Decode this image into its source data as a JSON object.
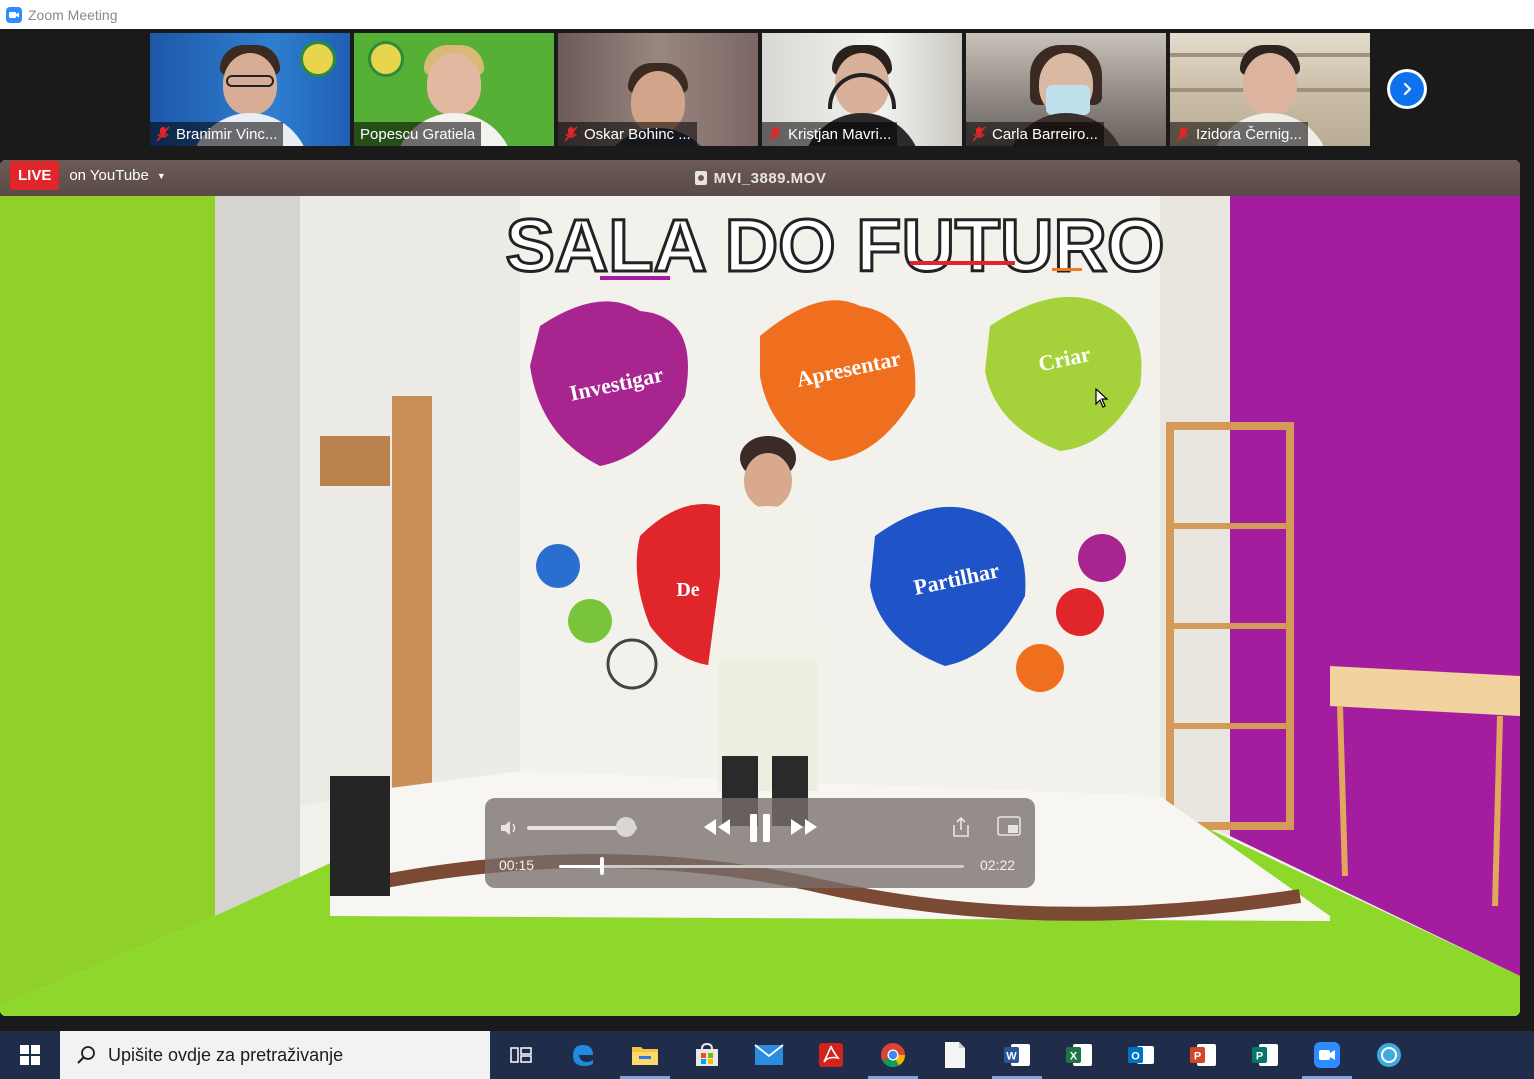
{
  "window": {
    "title": "Zoom Meeting"
  },
  "participants": [
    {
      "name": "Branimir Vinc...",
      "muted": true
    },
    {
      "name": "Popescu Gratiela",
      "muted": false
    },
    {
      "name": "Oskar Bohinc ...",
      "muted": true
    },
    {
      "name": "Kristjan Mavri...",
      "muted": true
    },
    {
      "name": "Carla Barreiro...",
      "muted": true
    },
    {
      "name": "Izidora Černig...",
      "muted": true
    }
  ],
  "live": {
    "badge": "LIVE",
    "platform": "on YouTube"
  },
  "video": {
    "filename": "MVI_3889.MOV",
    "current_time": "00:15",
    "duration": "02:22",
    "progress": 0.106,
    "volume": 0.9,
    "wall_heading": "SALA DO FUTURO",
    "leaves": [
      "Investigar",
      "Apresentar",
      "Criar",
      "De",
      "Partilhar"
    ]
  },
  "taskbar": {
    "search_placeholder": "Upišite ovdje za pretraživanje",
    "icons": [
      "task-view",
      "edge",
      "file-explorer",
      "store",
      "mail",
      "acrobat",
      "chrome",
      "file",
      "word",
      "excel",
      "outlook",
      "powerpoint",
      "publisher",
      "zoom",
      "app"
    ]
  },
  "colors": {
    "live_red": "#e0262a",
    "zoom_blue": "#0e72ed",
    "active_speaker": "#8de04a"
  }
}
